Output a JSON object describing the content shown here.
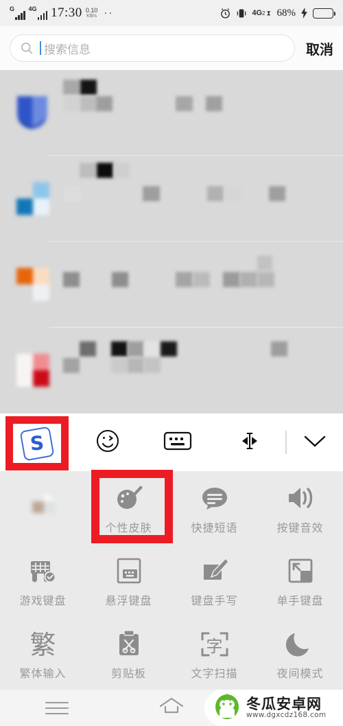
{
  "status_bar": {
    "signal_1_label": "G",
    "signal_2_label": "4G",
    "time": "17:30",
    "net_speed_value": "0.10",
    "net_speed_unit": "KB/s",
    "overflow_dots": "··",
    "alarm_icon": "alarm-clock-icon",
    "vibrate_icon": "bluetooth-vibrate-icon",
    "data_label": "4G",
    "data_sub": "2",
    "battery_percent": "68%",
    "charging_icon": "lightning-bolt-icon",
    "battery_level": 68
  },
  "search": {
    "placeholder": "搜索信息",
    "value": "",
    "cancel_label": "取消",
    "icon": "search-icon"
  },
  "results": {
    "rows": [
      {
        "name": "result-row-1",
        "icon_color": "#2f55c9"
      },
      {
        "name": "result-row-2",
        "icon_color": "#1277b8"
      },
      {
        "name": "result-row-3",
        "icon_color": "#e8650d"
      },
      {
        "name": "result-row-4",
        "icon_color": "#cc0b18"
      }
    ]
  },
  "keyboard_toolbar": {
    "items": [
      {
        "name": "sogou-logo-button",
        "icon": "sogou-s-logo-icon",
        "label": "S",
        "highlighted": true
      },
      {
        "name": "emoji-button",
        "icon": "smiley-face-icon"
      },
      {
        "name": "keyboard-button",
        "icon": "keyboard-icon"
      },
      {
        "name": "cursor-move-button",
        "icon": "text-cursor-arrows-icon"
      },
      {
        "name": "collapse-button",
        "icon": "chevron-down-icon"
      }
    ]
  },
  "function_panel": {
    "rows": [
      [
        {
          "label": "",
          "icon": "blurred-icon",
          "blurred": true,
          "name": "fn-item-blurred"
        },
        {
          "label": "个性皮肤",
          "icon": "palette-brush-icon",
          "highlighted": true,
          "name": "fn-item-skin"
        },
        {
          "label": "快捷短语",
          "icon": "speech-bubble-icon",
          "name": "fn-item-quick-phrases"
        },
        {
          "label": "按键音效",
          "icon": "speaker-sound-icon",
          "name": "fn-item-key-sound"
        }
      ],
      [
        {
          "label": "游戏键盘",
          "icon": "gamepad-check-icon",
          "name": "fn-item-game-keyboard"
        },
        {
          "label": "悬浮键盘",
          "icon": "floating-keyboard-icon",
          "name": "fn-item-floating-keyboard"
        },
        {
          "label": "键盘手写",
          "icon": "handwriting-pen-icon",
          "name": "fn-item-handwriting"
        },
        {
          "label": "单手键盘",
          "icon": "one-hand-keyboard-icon",
          "name": "fn-item-one-hand-keyboard"
        }
      ],
      [
        {
          "label": "繁体输入",
          "icon": "traditional-char-icon",
          "glyph": "繁",
          "name": "fn-item-traditional"
        },
        {
          "label": "剪贴板",
          "icon": "clipboard-scissors-icon",
          "name": "fn-item-clipboard"
        },
        {
          "label": "文字扫描",
          "icon": "text-scan-icon",
          "glyph": "字",
          "name": "fn-item-text-scan"
        },
        {
          "label": "夜间模式",
          "icon": "moon-icon",
          "name": "fn-item-night-mode"
        }
      ]
    ]
  },
  "nav_bar": {
    "menu_icon": "hamburger-menu-icon",
    "home_icon": "home-icon"
  },
  "watermark": {
    "title": "冬瓜安卓网",
    "url": "www.dgxcdz168.com",
    "logo": "green-melon-android-logo-icon"
  },
  "colors": {
    "highlight_red": "#ec1c24",
    "sogou_blue": "#2b5fd0",
    "caret_blue": "#3b8fe0",
    "panel_bg": "#eaeaea",
    "toolbar_bg": "#ffffff",
    "label_gray": "#9a9a9a",
    "watermark_green": "#5cb82a"
  }
}
